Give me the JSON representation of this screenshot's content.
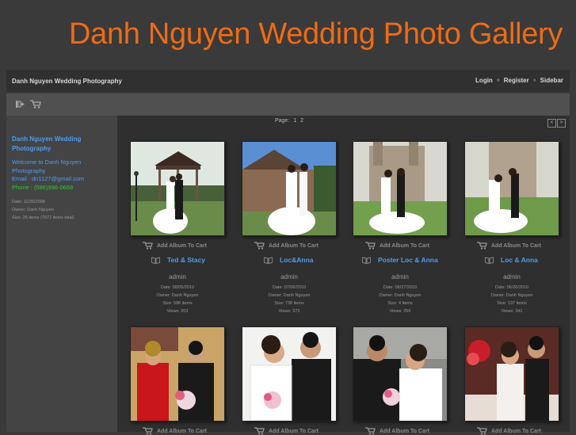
{
  "header": {
    "title": "Danh Nguyen Wedding Photo Gallery"
  },
  "nav": {
    "brand": "Danh Nguyen Wedding Photography",
    "links": [
      "Login",
      "Register",
      "Sidebar"
    ],
    "separator": "»"
  },
  "toolbar": {
    "icons": [
      "slideshow-icon",
      "cart-icon"
    ]
  },
  "sidebar": {
    "title": "Danh Nguyen Wedding Photography",
    "welcome": "Welcome to Danh Nguyen Photography",
    "email": "Email : dn1127@gmail.com",
    "phone": "Phone : (586)996-0668",
    "date": "Date: 11/25/2008",
    "owner": "Owner: Danh Nguyen",
    "size": "Size: 25 items (7672 items total)"
  },
  "pager": {
    "label": "Page:",
    "pages": [
      "1",
      "2"
    ],
    "prev": "<",
    "next": ">"
  },
  "albums": [
    {
      "cart": "Add Album To Cart",
      "title": "Ted & Stacy",
      "owner": "admin",
      "date": "Date: 08/05/2010",
      "owner_line": "Owner: Danh Nguyen",
      "size": "Size: 596 items",
      "views": "Views: 203"
    },
    {
      "cart": "Add Album To Cart",
      "title": "Loc&Anna",
      "owner": "admin",
      "date": "Date: 07/06/2010",
      "owner_line": "Owner: Danh Nguyen",
      "size": "Size: 738 items",
      "views": "Views: 372"
    },
    {
      "cart": "Add Album To Cart",
      "title": "Poster Loc & Anna",
      "owner": "admin",
      "date": "Date: 06/27/2010",
      "owner_line": "Owner: Danh Nguyen",
      "size": "Size: 4 items",
      "views": "Views: 256"
    },
    {
      "cart": "Add Album To Cart",
      "title": "Loc & Anna",
      "owner": "admin",
      "date": "Date: 06/26/2010",
      "owner_line": "Owner: Danh Nguyen",
      "size": "Size: 137 items",
      "views": "Views: 341"
    },
    {
      "cart": "Add Album To Cart"
    },
    {
      "cart": "Add Album To Cart"
    },
    {
      "cart": "Add Album To Cart"
    },
    {
      "cart": "Add Album To Cart"
    }
  ],
  "colors": {
    "title": "#ee6b16",
    "link": "#4f9cf0",
    "phone": "#29c832",
    "background": "#3a3a3a"
  }
}
